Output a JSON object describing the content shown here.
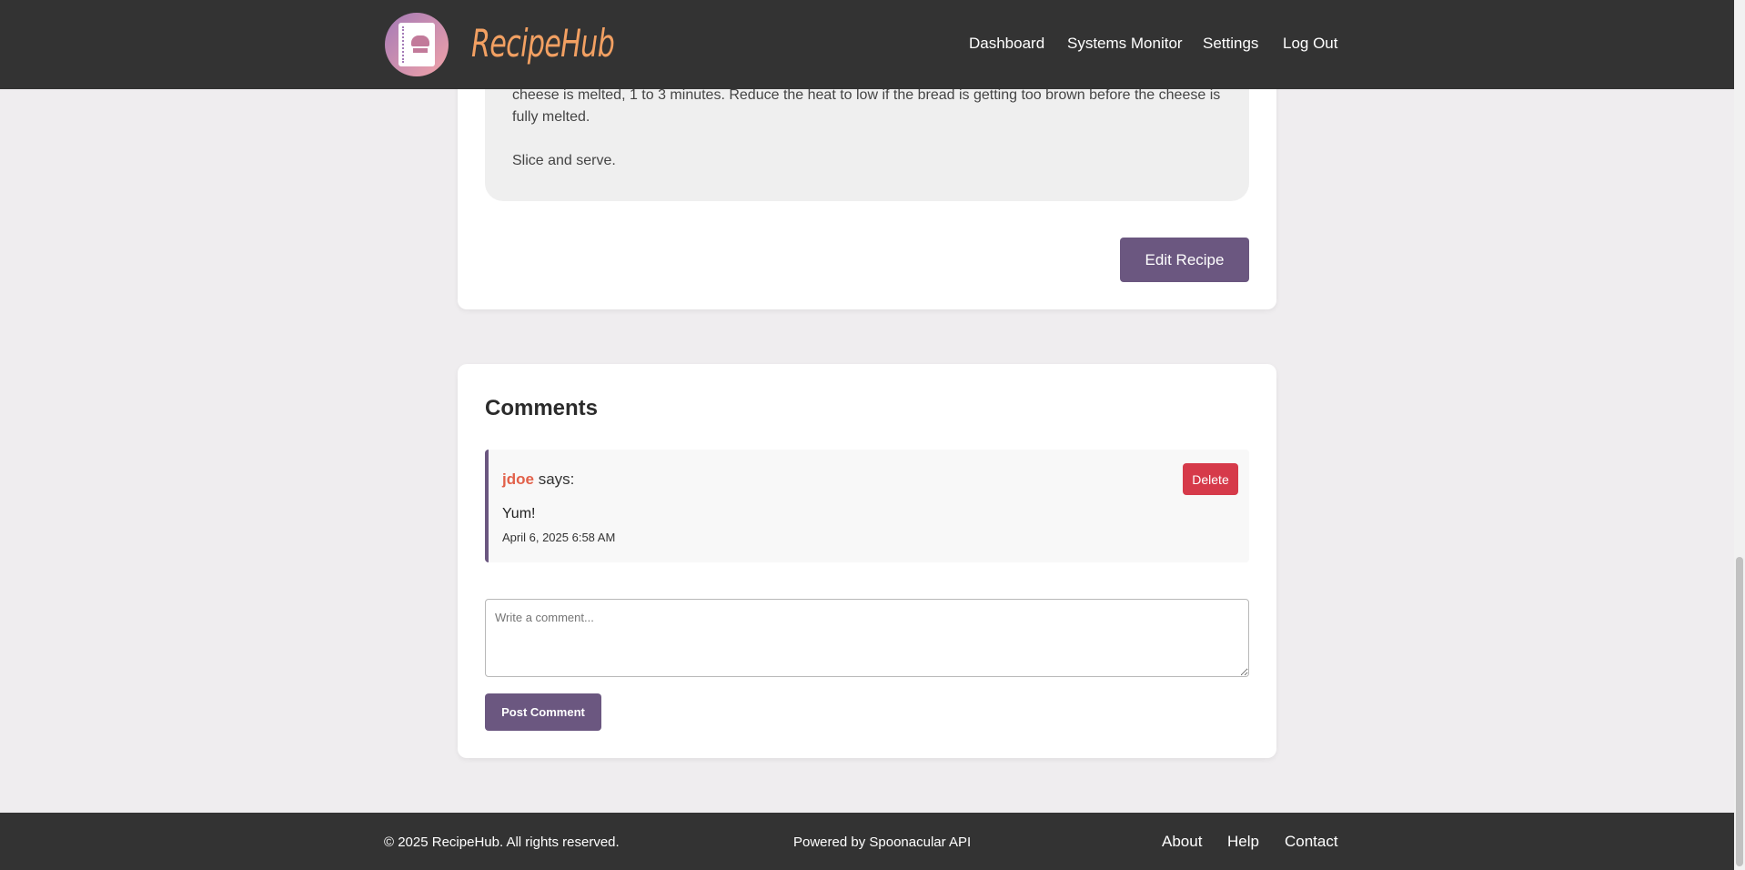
{
  "header": {
    "brand": "RecipeHub",
    "nav": [
      {
        "label": "Dashboard"
      },
      {
        "label": "Systems Monitor"
      },
      {
        "label": "Settings"
      },
      {
        "label": "Log Out"
      }
    ]
  },
  "recipe": {
    "instructions": [
      "cheese is melted, 1 to 3 minutes. Reduce the heat to low if the bread is getting too brown before the cheese is fully melted.",
      "Slice and serve."
    ],
    "edit_label": "Edit Recipe"
  },
  "comments": {
    "title": "Comments",
    "items": [
      {
        "user": "jdoe",
        "says": "says:",
        "text": "Yum!",
        "time": "April 6, 2025 6:58 AM",
        "delete_label": "Delete"
      }
    ],
    "input_placeholder": "Write a comment...",
    "post_label": "Post Comment"
  },
  "footer": {
    "copyright": "© 2025 RecipeHub. All rights reserved.",
    "powered": "Powered by Spoonacular API",
    "links": [
      {
        "label": "About"
      },
      {
        "label": "Help"
      },
      {
        "label": "Contact"
      }
    ]
  }
}
